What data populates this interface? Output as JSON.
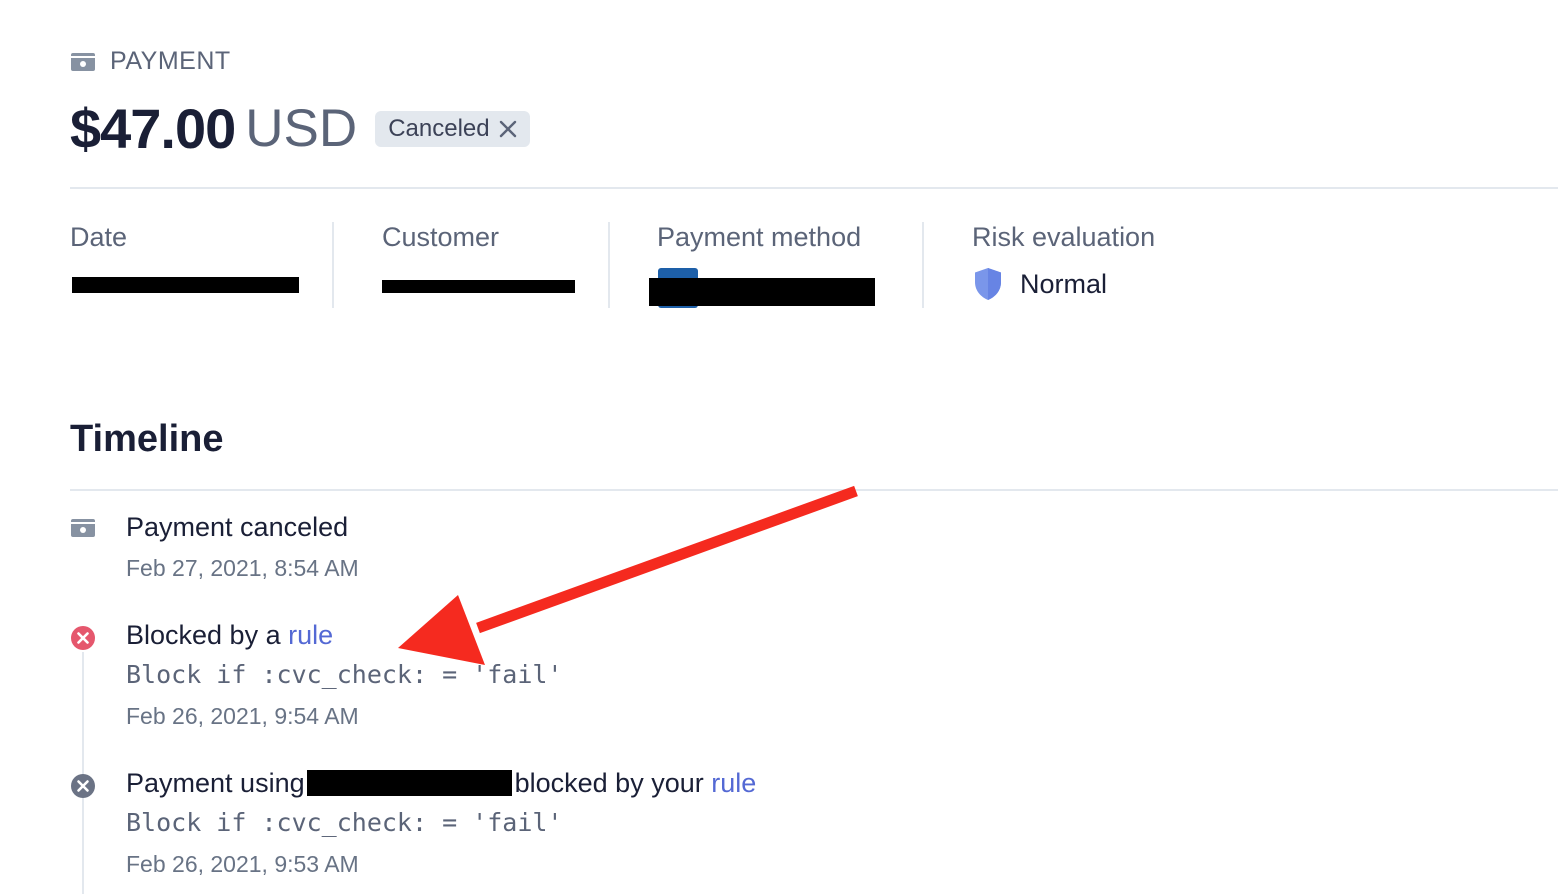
{
  "header": {
    "label": "PAYMENT",
    "amount": "$47.00",
    "currency": "USD",
    "status": "Canceled"
  },
  "summary": {
    "date_label": "Date",
    "customer_label": "Customer",
    "payment_method_label": "Payment method",
    "risk_label": "Risk evaluation",
    "risk_value": "Normal"
  },
  "timeline": {
    "title": "Timeline",
    "events": [
      {
        "title": "Payment canceled",
        "date": "Feb 27, 2021, 8:54 AM"
      },
      {
        "title_prefix": "Blocked by a ",
        "link": "rule",
        "code": "Block if :cvc_check: = 'fail'",
        "date": "Feb 26, 2021, 9:54 AM"
      },
      {
        "title_prefix": "Payment using",
        "title_suffix": "blocked by your ",
        "link": "rule",
        "code": "Block if :cvc_check: = 'fail'",
        "date": "Feb 26, 2021, 9:53 AM"
      }
    ]
  },
  "colors": {
    "link": "#5469d4",
    "error_icon": "#e5576d",
    "neutral_icon": "#6b7385",
    "shield": "#7a96ea",
    "annotation_arrow": "#f52a1f"
  },
  "icons": [
    "payment-card-icon",
    "close-icon",
    "shield-icon",
    "error-circle-icon",
    "cancel-circle-icon",
    "annotation-arrow"
  ]
}
